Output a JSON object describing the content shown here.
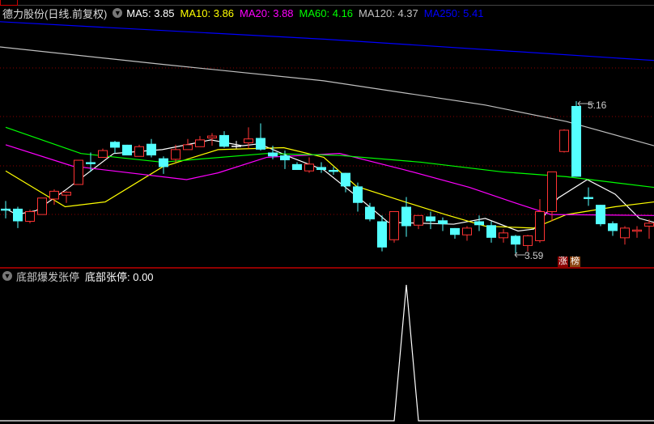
{
  "header": {
    "stock_title": "德力股份(日线.前复权)",
    "ma_labels": [
      {
        "text": "MA5: 3.85",
        "color": "#ffffff"
      },
      {
        "text": "MA10: 3.86",
        "color": "#ffff00"
      },
      {
        "text": "MA20: 3.88",
        "color": "#ff00ff"
      },
      {
        "text": "MA60: 4.16",
        "color": "#00ff00"
      },
      {
        "text": "MA120: 4.37",
        "color": "#c0c0c0"
      },
      {
        "text": "MA250: 5.41",
        "color": "#0000ff"
      }
    ]
  },
  "annotations": {
    "high_label": "5.16",
    "low_label": "3.59"
  },
  "badges": [
    {
      "text": "涨",
      "color": "#8b0000"
    },
    {
      "text": "榜",
      "color": "#8b4513"
    }
  ],
  "indicator": {
    "title": "底部爆发张停",
    "value_label": "底部张停: 0.00",
    "values_nonzero": {
      "33": 1
    }
  },
  "colors": {
    "up": "#ff3333",
    "down": "#54ffff",
    "grid": "#8b0000",
    "divider": "#c00000"
  },
  "chart_data": {
    "type": "candlestick",
    "ylim_reference": {
      "high": 5.16,
      "low": 3.59
    },
    "ohlc": [
      [
        4.05,
        4.13,
        3.95,
        4.03
      ],
      [
        4.05,
        4.07,
        3.85,
        3.92
      ],
      [
        3.92,
        4.04,
        3.9,
        4.02
      ],
      [
        3.99,
        4.16,
        3.99,
        4.16
      ],
      [
        4.15,
        4.25,
        4.09,
        4.23
      ],
      [
        4.19,
        4.23,
        4.11,
        4.22
      ],
      [
        4.3,
        4.55,
        4.3,
        4.55
      ],
      [
        4.53,
        4.63,
        4.43,
        4.51
      ],
      [
        4.58,
        4.67,
        4.58,
        4.65
      ],
      [
        4.74,
        4.75,
        4.62,
        4.68
      ],
      [
        4.71,
        4.71,
        4.6,
        4.6
      ],
      [
        4.59,
        4.71,
        4.59,
        4.69
      ],
      [
        4.72,
        4.77,
        4.58,
        4.6
      ],
      [
        4.57,
        4.59,
        4.41,
        4.48
      ],
      [
        4.56,
        4.71,
        4.53,
        4.66
      ],
      [
        4.66,
        4.77,
        4.66,
        4.71
      ],
      [
        4.69,
        4.8,
        4.69,
        4.76
      ],
      [
        4.78,
        4.83,
        4.7,
        4.8
      ],
      [
        4.81,
        4.85,
        4.68,
        4.69
      ],
      [
        4.7,
        4.75,
        4.67,
        4.7
      ],
      [
        4.73,
        4.89,
        4.67,
        4.77
      ],
      [
        4.78,
        4.93,
        4.65,
        4.66
      ],
      [
        4.63,
        4.7,
        4.56,
        4.59
      ],
      [
        4.6,
        4.65,
        4.46,
        4.55
      ],
      [
        4.51,
        4.53,
        4.45,
        4.45
      ],
      [
        4.44,
        4.58,
        4.42,
        4.51
      ],
      [
        4.48,
        4.53,
        4.42,
        4.45
      ],
      [
        4.45,
        4.48,
        4.4,
        4.43
      ],
      [
        4.42,
        4.42,
        4.22,
        4.28
      ],
      [
        4.28,
        4.32,
        4.02,
        4.11
      ],
      [
        4.07,
        4.11,
        3.92,
        3.94
      ],
      [
        3.92,
        3.98,
        3.61,
        3.65
      ],
      [
        3.73,
        4.02,
        3.7,
        4.02
      ],
      [
        4.07,
        4.17,
        3.76,
        3.87
      ],
      [
        3.88,
        3.98,
        3.84,
        3.98
      ],
      [
        3.97,
        4.02,
        3.84,
        3.92
      ],
      [
        3.93,
        3.96,
        3.82,
        3.89
      ],
      [
        3.85,
        3.85,
        3.74,
        3.78
      ],
      [
        3.78,
        3.87,
        3.72,
        3.85
      ],
      [
        3.92,
        3.98,
        3.82,
        3.88
      ],
      [
        3.88,
        3.92,
        3.7,
        3.75
      ],
      [
        3.75,
        3.84,
        3.7,
        3.8
      ],
      [
        3.77,
        3.78,
        3.59,
        3.68
      ],
      [
        3.67,
        3.78,
        3.61,
        3.77
      ],
      [
        3.72,
        4.15,
        3.7,
        4.02
      ],
      [
        4.02,
        4.43,
        3.92,
        4.43
      ],
      [
        4.64,
        4.87,
        4.63,
        4.86
      ],
      [
        5.11,
        5.16,
        4.38,
        4.38
      ],
      [
        4.17,
        4.27,
        4.08,
        4.15
      ],
      [
        4.09,
        4.09,
        3.87,
        3.89
      ],
      [
        3.9,
        3.92,
        3.77,
        3.82
      ],
      [
        3.75,
        3.87,
        3.68,
        3.85
      ],
      [
        3.82,
        3.87,
        3.75,
        3.83
      ],
      [
        3.87,
        3.94,
        3.74,
        3.9
      ]
    ],
    "ma_lines": [
      {
        "name": "MA5",
        "color": "#ffffff",
        "points": [
          [
            0,
            4.05
          ],
          [
            0.9,
            3.99
          ],
          [
            2.5,
            4.03
          ],
          [
            4.9,
            4.24
          ],
          [
            8.9,
            4.62
          ],
          [
            12.9,
            4.66
          ],
          [
            16.9,
            4.76
          ],
          [
            19.5,
            4.7
          ],
          [
            20.9,
            4.72
          ],
          [
            23.5,
            4.58
          ],
          [
            26.2,
            4.45
          ],
          [
            29.5,
            4.12
          ],
          [
            31.5,
            3.91
          ],
          [
            36.9,
            3.89
          ],
          [
            39.5,
            3.95
          ],
          [
            42.2,
            3.82
          ],
          [
            43.5,
            3.84
          ],
          [
            45.5,
            4.16
          ],
          [
            47.9,
            4.35
          ],
          [
            50.2,
            4.2
          ],
          [
            52.2,
            3.95
          ],
          [
            53.4,
            3.91
          ]
        ]
      },
      {
        "name": "MA10",
        "color": "#ffff00",
        "points": [
          [
            0,
            4.44
          ],
          [
            4.9,
            4.07
          ],
          [
            8.2,
            4.12
          ],
          [
            12.9,
            4.48
          ],
          [
            17.5,
            4.66
          ],
          [
            22.9,
            4.68
          ],
          [
            26.2,
            4.58
          ],
          [
            28.9,
            4.28
          ],
          [
            32.9,
            4.12
          ],
          [
            36.2,
            3.99
          ],
          [
            39.5,
            3.87
          ],
          [
            43.5,
            3.85
          ],
          [
            46.2,
            3.99
          ],
          [
            50.2,
            4.07
          ],
          [
            53.4,
            4.12
          ]
        ]
      },
      {
        "name": "MA20",
        "color": "#ff00ff",
        "points": [
          [
            0,
            4.71
          ],
          [
            5.5,
            4.49
          ],
          [
            14.9,
            4.35
          ],
          [
            17.5,
            4.42
          ],
          [
            21.5,
            4.58
          ],
          [
            27.5,
            4.62
          ],
          [
            32.9,
            4.45
          ],
          [
            38.2,
            4.27
          ],
          [
            42.2,
            4.1
          ],
          [
            44.9,
            3.99
          ],
          [
            53.4,
            3.98
          ]
        ]
      },
      {
        "name": "MA60",
        "color": "#00ff00",
        "points": [
          [
            0,
            4.89
          ],
          [
            6.2,
            4.62
          ],
          [
            12.9,
            4.53
          ],
          [
            21.5,
            4.62
          ],
          [
            27.5,
            4.6
          ],
          [
            34.2,
            4.53
          ],
          [
            40.9,
            4.43
          ],
          [
            46.2,
            4.38
          ],
          [
            53.4,
            4.27
          ]
        ]
      },
      {
        "name": "MA120",
        "color": "#c0c0c0",
        "points": [
          [
            -0.5,
            5.72
          ],
          [
            12.9,
            5.54
          ],
          [
            26.2,
            5.37
          ],
          [
            39.5,
            5.12
          ],
          [
            46.2,
            4.95
          ],
          [
            53.4,
            4.7
          ]
        ]
      },
      {
        "name": "MA250",
        "color": "#0000ff",
        "points": [
          [
            -0.5,
            5.98
          ],
          [
            26.2,
            5.8
          ],
          [
            53.4,
            5.58
          ]
        ]
      }
    ]
  }
}
